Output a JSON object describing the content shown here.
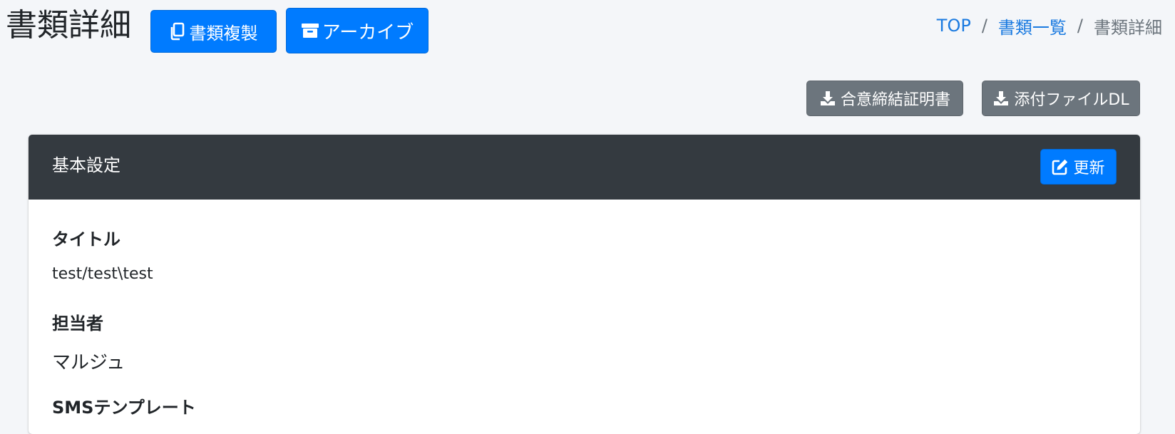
{
  "header": {
    "title": "書類詳細",
    "copy_button_label": "書類複製",
    "archive_button_label": "アーカイブ"
  },
  "breadcrumb": {
    "items": [
      "TOP",
      "書類一覧",
      "書類詳細"
    ],
    "separator": "/"
  },
  "actions": {
    "certificate_button_label": "合意締結証明書",
    "attachment_download_label": "添付ファイルDL"
  },
  "card": {
    "title": "基本設定",
    "update_button_label": "更新",
    "fields": [
      {
        "label": "タイトル",
        "value": "test/test\\test"
      },
      {
        "label": "担当者",
        "value": "マルジュ"
      },
      {
        "label": "SMSテンプレート",
        "value": ""
      }
    ]
  },
  "colors": {
    "primary": "#007bff",
    "secondary": "#6c757d",
    "card_header": "#343a40",
    "background": "#f4f6f9",
    "link": "#1a7ae0"
  },
  "icons": {
    "copy": "copy-icon",
    "archive": "archive-icon",
    "download": "download-icon",
    "edit": "edit-icon"
  }
}
